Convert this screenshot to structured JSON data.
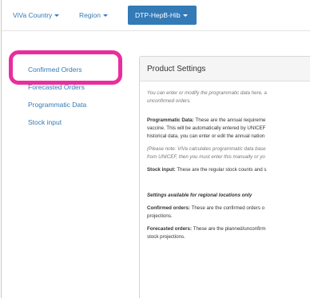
{
  "nav": {
    "items": [
      {
        "label": "ViVa Country"
      },
      {
        "label": "Region"
      }
    ],
    "active": {
      "label": "DTP-HepB-Hib"
    }
  },
  "sidebar": {
    "items": [
      {
        "label": "Confirmed Orders"
      },
      {
        "label": "Forecasted Orders"
      },
      {
        "label": "Programmatic Data"
      },
      {
        "label": "Stock input"
      }
    ]
  },
  "panel": {
    "title": "Product Settings",
    "intro": [
      "You can enter or modify the programmatic data here, a",
      "unconfirmed orders."
    ],
    "programmatic_label": "Programmatic Data:",
    "programmatic_lines": [
      " These are the annual requireme",
      "vaccine. This will be automatically entered by UNICEF",
      "historical data, you can enter or edit the annual nation"
    ],
    "note_lines": [
      "(Please note: ViVa calculates programmatic data base",
      "from UNICEF, then you must enter this manually or yo"
    ],
    "stock_label": "Stock input:",
    "stock_text": " These are the regular stock counts and s",
    "regional_heading": "Settings available for regional locations only",
    "confirmed_label": "Confirmed orders:",
    "confirmed_lines": [
      " These are the confirmed orders o",
      "projections."
    ],
    "forecasted_label": "Forecasted orders:",
    "forecasted_lines": [
      " These are the planned/unconfirm",
      "stock projections."
    ]
  },
  "colors": {
    "link": "#337ab7",
    "active_bg": "#337ab7",
    "highlight": "#ea2d9e"
  }
}
